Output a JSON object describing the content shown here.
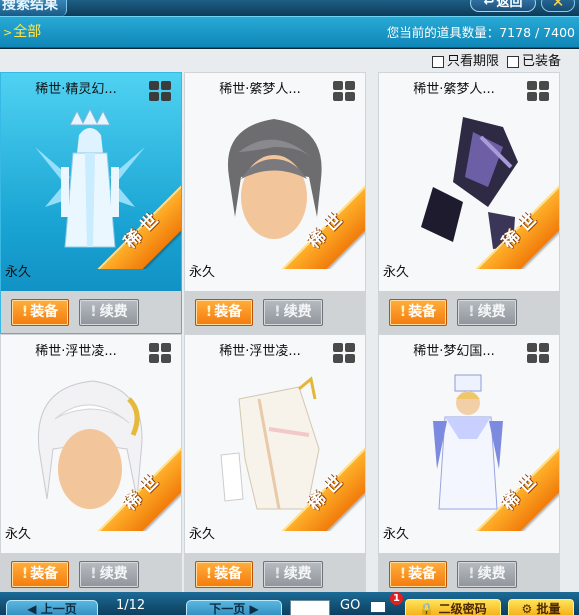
{
  "window": {
    "title": "搜索结果",
    "back_label": "返回",
    "close_glyph": "✕"
  },
  "header": {
    "all_tab": "全部",
    "count_label": "您当前的道具数量：",
    "count_value": "7178 / 7400"
  },
  "filters": [
    {
      "label": "只看期限",
      "checked": false
    },
    {
      "label": "已装备",
      "checked": false
    }
  ],
  "cards": [
    {
      "name": "稀世·精灵幻...",
      "duration": "永久",
      "rare_tag": "稀世",
      "equip_label": "装备",
      "renew_label": "续费",
      "selected": true,
      "art": "elf-king-icon"
    },
    {
      "name": "稀世·綮梦人...",
      "duration": "永久",
      "rare_tag": "稀世",
      "equip_label": "装备",
      "renew_label": "续费",
      "selected": false,
      "art": "gray-hair-icon"
    },
    {
      "name": "稀世·綮梦人...",
      "duration": "永久",
      "rare_tag": "稀世",
      "equip_label": "装备",
      "renew_label": "续费",
      "selected": false,
      "art": "dark-outfit-icon"
    },
    {
      "name": "稀世·浮世凌...",
      "duration": "永久",
      "rare_tag": "稀世",
      "equip_label": "装备",
      "renew_label": "续费",
      "selected": false,
      "art": "white-hair-icon"
    },
    {
      "name": "稀世·浮世凌...",
      "duration": "永久",
      "rare_tag": "稀世",
      "equip_label": "装备",
      "renew_label": "续费",
      "selected": false,
      "art": "white-robe-icon"
    },
    {
      "name": "稀世·梦幻国...",
      "duration": "永久",
      "rare_tag": "稀世",
      "equip_label": "装备",
      "renew_label": "续费",
      "selected": false,
      "art": "prince-icon"
    }
  ],
  "pagination": {
    "prev_label": "上一页",
    "page_indicator": "1/12",
    "next_label": "下一页",
    "go_label": "GO"
  },
  "mail": {
    "badge": "1"
  },
  "footer": {
    "password_label": "二级密码",
    "batch_label": "批量"
  },
  "colors": {
    "header": "#1a9ccd",
    "selected_card": "#18a2d2",
    "equip": "#f47b0d",
    "renew": "#9aa0a6",
    "rare_ribbon": "#f49a1c"
  }
}
